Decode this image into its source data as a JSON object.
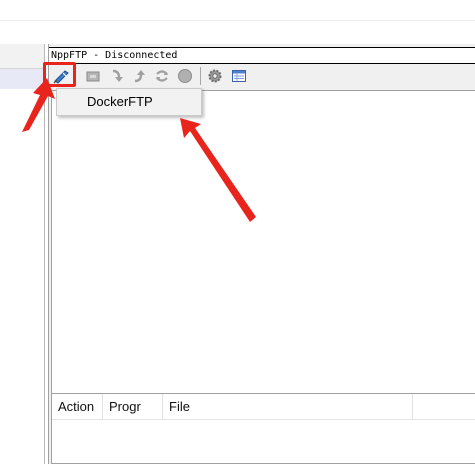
{
  "ftp_panel": {
    "title": "NppFTP - Disconnected"
  },
  "toolbar": {
    "buttons": [
      {
        "icon": "connect-icon",
        "enabled": true
      },
      {
        "icon": "folder-refresh-icon",
        "enabled": false
      },
      {
        "icon": "download-icon",
        "enabled": false
      },
      {
        "icon": "upload-icon",
        "enabled": false
      },
      {
        "icon": "sync-icon",
        "enabled": false
      },
      {
        "icon": "abort-icon",
        "enabled": false
      },
      {
        "icon": "settings-gear-icon",
        "enabled": true
      },
      {
        "icon": "message-window-icon",
        "enabled": true
      }
    ]
  },
  "connect_menu": {
    "items": [
      {
        "label": "DockerFTP"
      }
    ]
  },
  "queue": {
    "columns": [
      "Action",
      "Progr",
      "File"
    ]
  },
  "colors": {
    "annotation_red": "#e8251d",
    "panel_bg": "#f0f0f0"
  }
}
